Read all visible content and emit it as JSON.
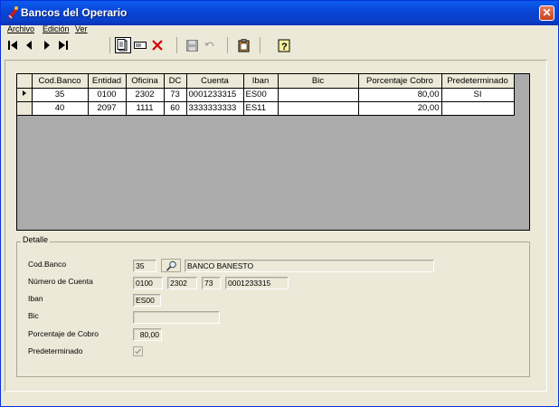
{
  "window": {
    "title": "Bancos del Operario"
  },
  "menu": [
    "Archivo",
    "Edición",
    "Ver"
  ],
  "grid": {
    "headers": [
      "Cod.Banco",
      "Entidad",
      "Oficina",
      "DC",
      "Cuenta",
      "Iban",
      "Bic",
      "Porcentaje Cobro",
      "Predeterminado"
    ],
    "rows": [
      {
        "cod": "35",
        "entidad": "0100",
        "oficina": "2302",
        "dc": "73",
        "cuenta": "0001233315",
        "iban": "ES00",
        "bic": "",
        "porcentaje": "80,00",
        "pred": "SI"
      },
      {
        "cod": "40",
        "entidad": "2097",
        "oficina": "1111",
        "dc": "60",
        "cuenta": "3333333333",
        "iban": "ES11",
        "bic": "",
        "porcentaje": "20,00",
        "pred": ""
      }
    ]
  },
  "detalle": {
    "legend": "Detalle",
    "labels": {
      "cod_banco": "Cod.Banco",
      "numero_cuenta": "Número de Cuenta",
      "iban": "Iban",
      "bic": "Bic",
      "porcentaje": "Porcentaje de Cobro",
      "predeterminado": "Predeterminado"
    },
    "values": {
      "cod_banco": "35",
      "banco_nombre": "BANCO BANESTO",
      "entidad": "0100",
      "oficina": "2302",
      "dc": "73",
      "cuenta": "0001233315",
      "iban": "ES00",
      "bic": "",
      "porcentaje": "80,00",
      "predeterminado_checked": true
    }
  }
}
